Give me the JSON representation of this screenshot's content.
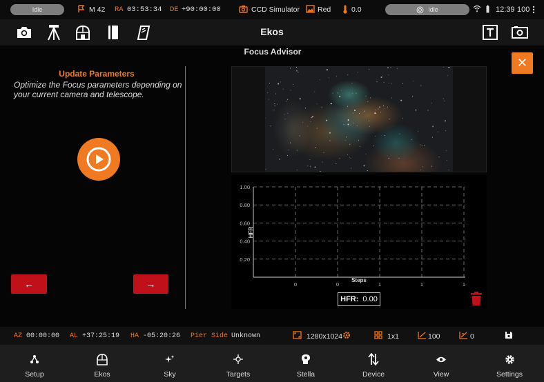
{
  "status": {
    "left_pill": "Idle",
    "target": "M 42",
    "ra_label": "RA",
    "ra_value": "03:53:34",
    "de_label": "DE",
    "de_value": "+90:00:00",
    "camera": "CCD Simulator",
    "filter": "Red",
    "temperature": "0.0",
    "right_pill": "Idle",
    "time": "12:39",
    "battery": "100"
  },
  "toolbar": {
    "title": "Ekos"
  },
  "left_panel": {
    "title": "Update Parameters",
    "description": "Optimize the Focus parameters depending on your current camera and telescope.",
    "prev_label": "←",
    "next_label": "→"
  },
  "focus_advisor": {
    "title": "Focus Advisor",
    "close_label": "✕",
    "hfr_label": "HFR:",
    "hfr_value": "0.00"
  },
  "chart_data": {
    "type": "line",
    "xlabel": "Steps",
    "ylabel": "HFR",
    "ylim": [
      0,
      1.0
    ],
    "y_ticks": [
      "1.00",
      "0.80",
      "0.60",
      "0.40",
      "0.20"
    ],
    "x_ticks": [
      "0",
      "0",
      "1",
      "1",
      "1"
    ],
    "grid": true,
    "series": []
  },
  "info": {
    "az_label": "AZ",
    "az_value": "00:00:00",
    "al_label": "AL",
    "al_value": "+37:25:19",
    "ha_label": "HA",
    "ha_value": "-05:20:26",
    "pier_label": "Pier Side",
    "pier_value": "Unknown",
    "resolution": "1280x1024",
    "binning": "1x1",
    "gain": "100",
    "offset": "0"
  },
  "nav": {
    "items": [
      {
        "label": "Setup",
        "icon": "setup-icon"
      },
      {
        "label": "Ekos",
        "icon": "ekos-icon"
      },
      {
        "label": "Sky",
        "icon": "sky-icon"
      },
      {
        "label": "Targets",
        "icon": "targets-icon"
      },
      {
        "label": "Stella",
        "icon": "stella-icon"
      },
      {
        "label": "Device",
        "icon": "device-icon"
      },
      {
        "label": "View",
        "icon": "view-icon"
      },
      {
        "label": "Settings",
        "icon": "settings-icon"
      }
    ]
  },
  "colors": {
    "accent": "#f07a22",
    "danger": "#c0101a"
  }
}
